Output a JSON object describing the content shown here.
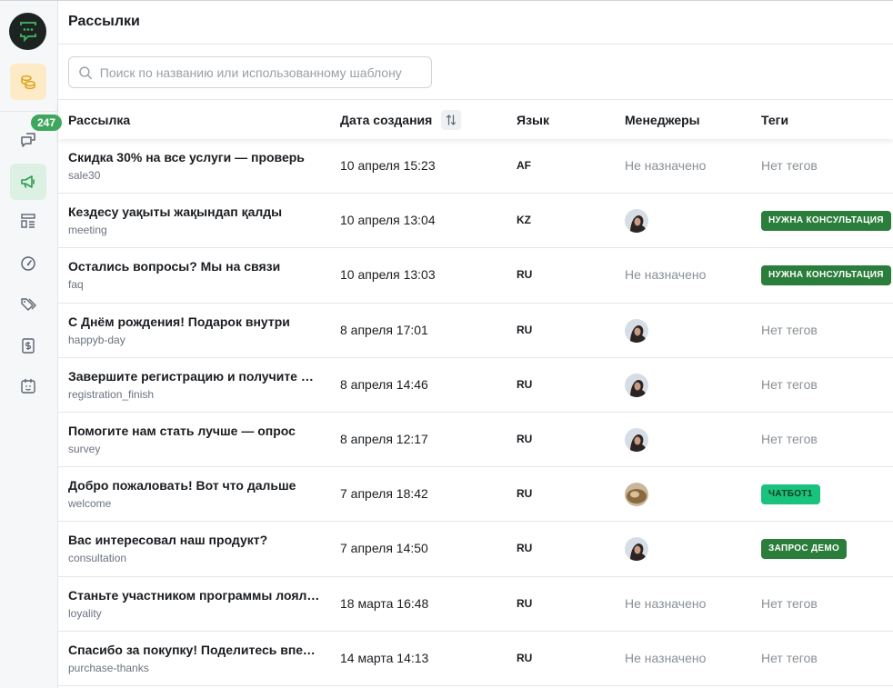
{
  "sidebar": {
    "badge": "247",
    "items": [
      {
        "name": "sidebar-item-billing",
        "icon": "coins-icon"
      },
      {
        "name": "sidebar-item-chats",
        "icon": "chat-bubbles-icon"
      },
      {
        "name": "sidebar-item-broadcasts",
        "icon": "megaphone-icon"
      },
      {
        "name": "sidebar-item-templates",
        "icon": "layout-list-icon"
      },
      {
        "name": "sidebar-item-analytics",
        "icon": "gauge-icon"
      },
      {
        "name": "sidebar-item-tags",
        "icon": "tags-icon"
      },
      {
        "name": "sidebar-item-payments",
        "icon": "receipt-dollar-icon"
      },
      {
        "name": "sidebar-item-bots",
        "icon": "bot-calendar-icon"
      }
    ]
  },
  "header": {
    "title": "Рассылки"
  },
  "search": {
    "placeholder": "Поиск по названию или использованному шаблону",
    "value": ""
  },
  "table": {
    "columns": {
      "name": "Рассылка",
      "date": "Дата создания",
      "lang": "Язык",
      "managers": "Менеджеры",
      "tags": "Теги"
    },
    "rows": [
      {
        "title": "Скидка 30% на все услуги — проверь",
        "slug": "sale30",
        "date": "10 апреля 15:23",
        "lang": "AF",
        "manager": "Не назначено",
        "tag": "Нет тегов"
      },
      {
        "title": "Кездесу уақыты жақындап қалды",
        "slug": "meeting",
        "date": "10 апреля 13:04",
        "lang": "KZ",
        "manager": "",
        "tag": "НУЖНА КОНСУЛЬТАЦИЯ"
      },
      {
        "title": "Остались вопросы? Мы на связи",
        "slug": "faq",
        "date": "10 апреля 13:03",
        "lang": "RU",
        "manager": "Не назначено",
        "tag": "НУЖНА КОНСУЛЬТАЦИЯ"
      },
      {
        "title": "С Днём рождения! Подарок внутри",
        "slug": "happyb-day",
        "date": "8 апреля 17:01",
        "lang": "RU",
        "manager": "",
        "tag": "Нет тегов"
      },
      {
        "title": "Завершите регистрацию и получите бонус",
        "slug": "registration_finish",
        "date": "8 апреля 14:46",
        "lang": "RU",
        "manager": "",
        "tag": "Нет тегов"
      },
      {
        "title": "Помогите нам стать лучше — опрос",
        "slug": "survey",
        "date": "8 апреля 12:17",
        "lang": "RU",
        "manager": "",
        "tag": "Нет тегов"
      },
      {
        "title": "Добро пожаловать! Вот что дальше",
        "slug": "welcome",
        "date": "7 апреля 18:42",
        "lang": "RU",
        "manager": "",
        "tag": "ЧАТБОТ1"
      },
      {
        "title": "Вас интересовал наш продукт?",
        "slug": "consultation",
        "date": "7 апреля 14:50",
        "lang": "RU",
        "manager": "",
        "tag": "ЗАПРОС ДЕМО"
      },
      {
        "title": "Станьте участником программы лояльности",
        "slug": "loyality",
        "date": "18 марта 16:48",
        "lang": "RU",
        "manager": "Не назначено",
        "tag": "Нет тегов"
      },
      {
        "title": "Спасибо за покупку! Поделитесь впечатлением",
        "slug": "purchase-thanks",
        "date": "14 марта 14:13",
        "lang": "RU",
        "manager": "Не назначено",
        "tag": "Нет тегов"
      }
    ]
  },
  "colors": {
    "accent": "#3ea75d",
    "tag_dark": "#2a7d3a",
    "tag_bright": "#19c37d"
  }
}
